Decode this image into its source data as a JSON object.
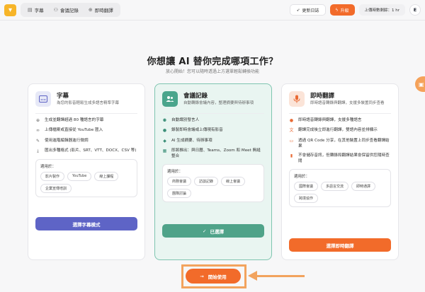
{
  "header": {
    "logo_icon": "app-logo",
    "nav": [
      {
        "label": "字幕",
        "icon": "subtitle-icon"
      },
      {
        "label": "會議記錄",
        "icon": "people-icon"
      },
      {
        "label": "即時翻譯",
        "icon": "globe-icon"
      }
    ],
    "update_log_label": "更新日誌",
    "upgrade_label": "升級",
    "usage_text": "上傳時數剩餘：1 hr",
    "avatar_initial": "E"
  },
  "headline": {
    "title": "你想讓 AI 替你完成哪項工作？",
    "subtitle": "放心開始！您可以隨時透過上方選單輕鬆轉換功能"
  },
  "cards": [
    {
      "title": "字幕",
      "desc": "為您的影音輕鬆生成多語言精準字幕",
      "features": [
        "生成並翻譯超過 80 種語言的字幕",
        "上傳檔案或直接從 YouTube 匯入",
        "使用進階編輯器進行微調",
        "匯出多種格式 (影片、SRT、VTT、DOCX、CSV 等)"
      ],
      "suit_label": "適用於：",
      "tags": [
        "影片製作",
        "YouTube",
        "線上課程",
        "企業宣傳培訓"
      ],
      "button": "選擇字幕模式"
    },
    {
      "title": "會議記錄",
      "desc": "自動轉錄會議內容，整理摘要與待辦事項",
      "features": [
        "自動識別發言人",
        "錄製即時會議或上傳現有影音",
        "AI 生成摘要、待辦事項",
        "即將推出：與日曆、Teams、Zoom 和 Meet 無縫整合"
      ],
      "suit_label": "適用於：",
      "tags": [
        "商務會議",
        "訪談記錄",
        "線上會議",
        "團隊討論"
      ],
      "button": "已選擇"
    },
    {
      "title": "即時翻譯",
      "desc": "即時語音轉錄與翻譯，支援多裝置同步查看",
      "features": [
        "即時語音轉錄與翻譯，支援多種語言",
        "翻譯完成後立即進行翻譯，雙語內容並排顯示",
        "透過 QR Code 分享，在其他裝置上同步查看翻譯結果",
        "不會儲存音訊，但轉錄和翻譯結果會保留供您隨時查閱"
      ],
      "suit_label": "適用於：",
      "tags": [
        "國際會議",
        "多語言交流",
        "即時通譯",
        "跨境協作"
      ],
      "button": "選擇即時翻譯"
    }
  ],
  "cta": {
    "label": "開始使用"
  },
  "colors": {
    "accent": "#f26b2a",
    "teal": "#4fa389",
    "purple": "#5e64c6"
  }
}
